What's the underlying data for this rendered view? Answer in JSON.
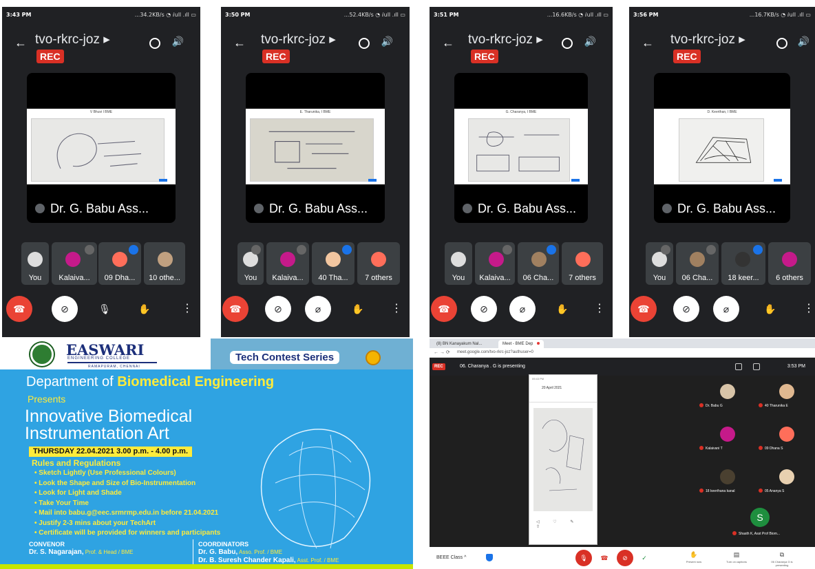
{
  "phones": [
    {
      "time": "3:43 PM",
      "status": "...34.2KB/s ◔ ⅈull .ıll ▭",
      "title": "tvo-rkrc-joz ▸",
      "rec": "REC",
      "shared_caption": "V Bhuvi I BME",
      "tile_name": "Dr. G. Babu Ass...",
      "participants": [
        {
          "label": "You",
          "color": "#ddd",
          "state": ""
        },
        {
          "label": "Kalaiva...",
          "color": "#c51a8a",
          "state": "muted"
        },
        {
          "label": "09 Dha...",
          "color": "#ff6e5a",
          "state": "talk"
        },
        {
          "label": "10 othe...",
          "color": "#c0a080",
          "state": ""
        }
      ]
    },
    {
      "time": "3:50 PM",
      "status": "...52.4KB/s ◔ ⅈull .ıll ▭",
      "title": "tvo-rkrc-joz ▸",
      "rec": "REC",
      "shared_caption": "E. Tharunika, I BME",
      "tile_name": "Dr. G. Babu Ass...",
      "participants": [
        {
          "label": "You",
          "color": "#ddd",
          "state": "muted"
        },
        {
          "label": "Kalaiva...",
          "color": "#c51a8a",
          "state": "muted"
        },
        {
          "label": "40 Tha...",
          "color": "#f2c6a0",
          "state": "talk"
        },
        {
          "label": "7 others",
          "color": "#ff6e5a",
          "state": ""
        }
      ]
    },
    {
      "time": "3:51 PM",
      "status": "...16.6KB/s ◔ ⅈull .ıll ▭",
      "title": "tvo-rkrc-joz ▸",
      "rec": "REC",
      "shared_caption": "G. Charanya, I BME",
      "tile_name": "Dr. G. Babu Ass...",
      "participants": [
        {
          "label": "You",
          "color": "#ddd",
          "state": ""
        },
        {
          "label": "Kalaiva...",
          "color": "#c51a8a",
          "state": "muted"
        },
        {
          "label": "06 Cha...",
          "color": "#a08060",
          "state": "talk"
        },
        {
          "label": "7 others",
          "color": "#ff6e5a",
          "state": ""
        }
      ]
    },
    {
      "time": "3:56 PM",
      "status": "...16.7KB/s ◔ ⅈull .ıll ▭",
      "title": "tvo-rkrc-joz ▸",
      "rec": "REC",
      "shared_caption": "D. Keerthan, I BME",
      "tile_name": "Dr. G. Babu Ass...",
      "participants": [
        {
          "label": "You",
          "color": "#ddd",
          "state": "muted"
        },
        {
          "label": "06 Cha...",
          "color": "#a08060",
          "state": "muted"
        },
        {
          "label": "18 keer...",
          "color": "#333",
          "state": "talk"
        },
        {
          "label": "6 others",
          "color": "#c51a8a",
          "state": ""
        }
      ]
    }
  ],
  "poster": {
    "college": "EASWARI",
    "college_sub": "ENGINEERING COLLEGE",
    "college_city": "RAMAPURAM, CHENNAI",
    "series": "Tech Contest Series",
    "dept_pre": "Department of ",
    "dept": "Biomedical Engineering",
    "presents": "Presents",
    "title1": "Innovative Biomedical",
    "title2": "Instrumentation Art",
    "date": "THURSDAY   22.04.2021  3.00 p.m. - 4.00 p.m.",
    "rules_title": "Rules and Regulations",
    "rules": [
      "Sketch Lightly (Use Professional Colours)",
      "Look the Shape and Size of Bio-Instrumentation",
      "Look for Light and Shade",
      "Take Your Time",
      "Mail into babu.g@eec.srmrmp.edu.in before 21.04.2021",
      "Justify 2-3 mins about your TechArt",
      "Certificate will be provided for winners and participants"
    ],
    "convenor_head": "CONVENOR",
    "convenor_name": "Dr. S. Nagarajan,",
    "convenor_role": " Prof. & Head / BME",
    "coord_head": "COORDINATORS",
    "coord1_name": "Dr. G. Babu,",
    "coord1_role": " Asso. Prof. / BME",
    "coord2_name": "Dr. B. Suresh Chander Kapali,",
    "coord2_role": " Asst. Prof. / BME"
  },
  "browser": {
    "tab1": "(8) BN Kanayakum Nal...",
    "tab2": "Meet - BME Dep",
    "url": "meet.google.com/tvo-rkrc-joz?authuser=0",
    "rec": "REC",
    "presenting": "06. Charanya . G is presenting",
    "time": "3:53 PM",
    "phone_header": "20 April 2021",
    "phone_status": "09:43 PM",
    "grid": [
      {
        "name": "Dr. Babu G",
        "color": "#d8c4a8"
      },
      {
        "name": "40 Tharunika E",
        "color": "#e0b890"
      },
      {
        "name": "Kalaivani T",
        "color": "#c51a8a"
      },
      {
        "name": "09 Dhana S",
        "color": "#ff6e5a"
      },
      {
        "name": "18 keerthana kanal",
        "color": "#4a4030"
      },
      {
        "name": "05 Ananya S",
        "color": "#e8d0b0"
      }
    ],
    "s_avatar": "S",
    "s_name": "Shasth K, Asst Prof Biom...",
    "meeting_code": "BEEE Class ^",
    "btn_present": "Present now",
    "btn_activity": "Turn on captions",
    "btn_presenting": "06 Charanya G is presenting"
  }
}
